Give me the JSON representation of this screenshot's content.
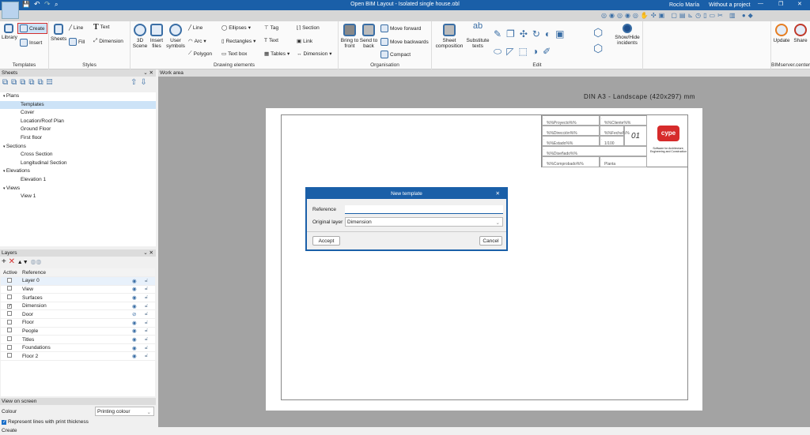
{
  "window": {
    "title": "Open BIM Layout - Isolated single house.obl",
    "user": "Rocío María",
    "project": "Without a project"
  },
  "ribbon": {
    "templates": {
      "label": "Templates",
      "library": "Library",
      "create": "Create",
      "insert": "Insert"
    },
    "styles": {
      "label": "Styles",
      "sheets": "Sheets",
      "line": "Line",
      "text": "Text",
      "fill": "Fill",
      "dimension": "Dimension"
    },
    "drawing": {
      "label": "Drawing elements",
      "scene": "3D Scene",
      "insert_files": "Insert files",
      "user_symbols": "User symbols",
      "line": "Line",
      "arc": "Arc",
      "polygon": "Polygon",
      "ellipses": "Ellipses",
      "rectangles": "Rectangles",
      "text_box": "Text box",
      "tag": "Tag",
      "text": "Text",
      "tables": "Tables",
      "section": "Section",
      "link": "Link",
      "dimension": "Dimension"
    },
    "organisation": {
      "label": "Organisation",
      "bring_front": "Bring to front",
      "send_back": "Send to back",
      "move_forward": "Move forward",
      "move_backwards": "Move backwards",
      "compact": "Compact"
    },
    "edit": {
      "label": "Edit",
      "sheet_composition": "Sheet composition",
      "substitute_texts": "Substitute texts",
      "show_hide": "Show/Hide incidents"
    },
    "bim": {
      "label": "BIMserver.center",
      "update": "Update",
      "share": "Share"
    }
  },
  "sheets": {
    "title": "Sheets",
    "tree": [
      {
        "label": "Plans",
        "level": 0
      },
      {
        "label": "Templates",
        "level": 1,
        "selected": true
      },
      {
        "label": "Cover",
        "level": 1
      },
      {
        "label": "Location/Roof Plan",
        "level": 1
      },
      {
        "label": "Ground Floor",
        "level": 1
      },
      {
        "label": "First floor",
        "level": 1
      },
      {
        "label": "Sections",
        "level": 0
      },
      {
        "label": "Cross Section",
        "level": 1
      },
      {
        "label": "Longitudinal Section",
        "level": 1
      },
      {
        "label": "Elevations",
        "level": 0
      },
      {
        "label": "Elevation 1",
        "level": 1
      },
      {
        "label": "Views",
        "level": 0
      },
      {
        "label": "View 1",
        "level": 1
      }
    ]
  },
  "layers": {
    "title": "Layers",
    "col_active": "Active",
    "col_reference": "Reference",
    "rows": [
      {
        "name": "Layer 0",
        "active": false,
        "visible": true
      },
      {
        "name": "View",
        "active": false,
        "visible": true
      },
      {
        "name": "Surfaces",
        "active": false,
        "visible": true
      },
      {
        "name": "Dimension",
        "active": true,
        "visible": true
      },
      {
        "name": "Door",
        "active": false,
        "visible": false
      },
      {
        "name": "Floor",
        "active": false,
        "visible": true
      },
      {
        "name": "People",
        "active": false,
        "visible": true
      },
      {
        "name": "Titles",
        "active": false,
        "visible": true
      },
      {
        "name": "Foundations",
        "active": false,
        "visible": true
      },
      {
        "name": "Floor 2",
        "active": false,
        "visible": true
      }
    ]
  },
  "view_on_screen": {
    "title": "View on screen",
    "colour_label": "Colour",
    "colour_value": "Printing colour",
    "print_thickness": "Represent lines with print thickness",
    "print_thickness_checked": true
  },
  "status": "Create",
  "work_area": {
    "title": "Work area",
    "sheet_format": "DIN A3 - Landscape (420x297) mm",
    "title_block": {
      "project": "%%Proyecto%%",
      "client": "%%Cliente%%",
      "content": "%%Dirección%%",
      "date": "%%Fecha%%",
      "state": "%%Estado%%",
      "scale": "1/100",
      "drawn": "%%Diseñado%%",
      "checked": "%%Comprobado%%",
      "floor": "Planta",
      "number": "01",
      "logo": "cype",
      "logo_sub": "Software for Architecture, Engineering and Construction"
    }
  },
  "dialog": {
    "title": "New template",
    "reference_label": "Reference",
    "reference_value": "",
    "layer_label": "Original layer",
    "layer_value": "Dimension",
    "accept": "Accept",
    "cancel": "Cancel"
  },
  "colors": {
    "titlebar": "#1a5fa8",
    "accent_highlight": "#d32f2f",
    "selection": "#cde3f7"
  }
}
